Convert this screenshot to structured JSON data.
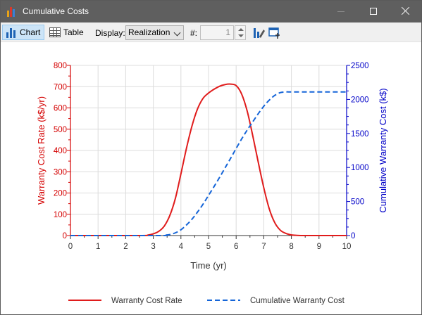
{
  "window": {
    "title": "Cumulative Costs"
  },
  "toolbar": {
    "chart_label": "Chart",
    "table_label": "Table",
    "display_label": "Display:",
    "display_value": "Realization",
    "number_label": "#:",
    "number_value": "1"
  },
  "colors": {
    "left_axis": "#d40000",
    "right_axis": "#0000c8",
    "rate_line": "#e01c1c",
    "cumulative_line": "#1565d8"
  },
  "chart_data": {
    "type": "line",
    "xlabel": "Time (yr)",
    "ylabel_left": "Warranty Cost Rate (k$/yr)",
    "ylabel_right": "Cumulative Warranty Cost (k$)",
    "xlim": [
      0,
      10
    ],
    "ylim_left": [
      0,
      800
    ],
    "ylim_right": [
      0,
      2500
    ],
    "x_ticks": [
      "0",
      "1",
      "2",
      "3",
      "4",
      "5",
      "6",
      "7",
      "8",
      "9",
      "10"
    ],
    "y_ticks_left": [
      "0",
      "100",
      "200",
      "300",
      "400",
      "500",
      "600",
      "700",
      "800"
    ],
    "y_ticks_right": [
      "0",
      "500",
      "1000",
      "1500",
      "2000",
      "2500"
    ],
    "grid": true,
    "legend_position": "bottom",
    "series": [
      {
        "name": "Warranty Cost Rate",
        "axis": "left",
        "style": "solid",
        "x": [
          0,
          2.5,
          2.8,
          3.0,
          3.2,
          3.4,
          3.6,
          3.8,
          4.0,
          4.2,
          4.4,
          4.6,
          4.8,
          5.0,
          5.2,
          5.4,
          5.6,
          5.8,
          6.0,
          6.2,
          6.4,
          6.6,
          6.8,
          7.0,
          7.2,
          7.4,
          7.6,
          7.8,
          8.0,
          8.2,
          8.5,
          9.0,
          10.0
        ],
        "y": [
          0,
          0,
          2,
          8,
          20,
          45,
          95,
          175,
          290,
          410,
          515,
          595,
          645,
          670,
          688,
          702,
          710,
          712,
          705,
          665,
          585,
          470,
          345,
          225,
          125,
          60,
          25,
          10,
          3,
          1,
          0,
          0,
          0
        ]
      },
      {
        "name": "Cumulative Warranty Cost",
        "axis": "right",
        "style": "dashed",
        "x": [
          0,
          3.2,
          3.4,
          3.6,
          3.8,
          4.0,
          4.2,
          4.4,
          4.6,
          4.8,
          5.0,
          5.2,
          5.4,
          5.6,
          5.8,
          6.0,
          6.2,
          6.4,
          6.6,
          6.8,
          7.0,
          7.2,
          7.4,
          7.6,
          7.8,
          8.0,
          8.5,
          9.0,
          10.0
        ],
        "y": [
          0,
          0,
          5,
          15,
          40,
          85,
          155,
          240,
          345,
          460,
          590,
          720,
          855,
          995,
          1135,
          1280,
          1420,
          1550,
          1670,
          1790,
          1900,
          1990,
          2060,
          2100,
          2110,
          2110,
          2110,
          2110,
          2110
        ]
      }
    ]
  }
}
